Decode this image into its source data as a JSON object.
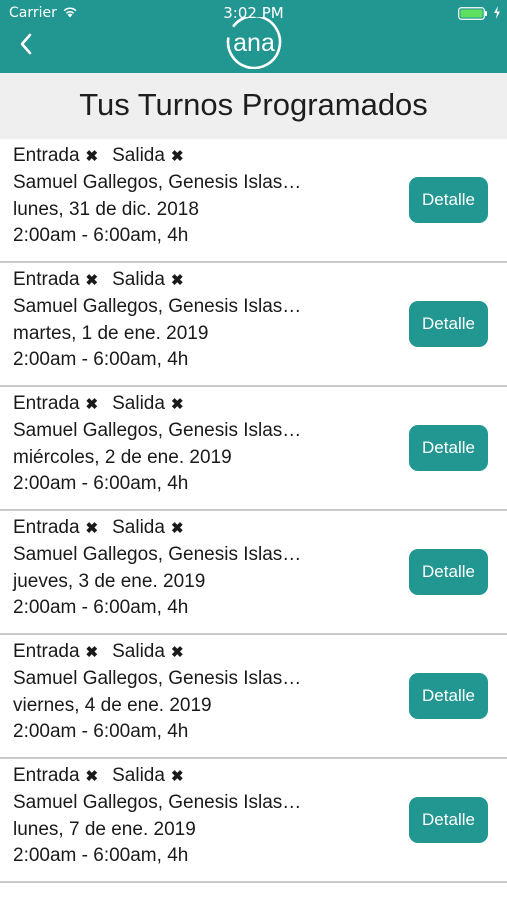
{
  "status_bar": {
    "carrier": "Carrier",
    "time": "3:02 PM"
  },
  "header": {
    "background_color": "#229691",
    "logo_text": "ana"
  },
  "page": {
    "title": "Tus Turnos Programados"
  },
  "shifts": [
    {
      "entrada_label": "Entrada",
      "salida_label": "Salida",
      "x_mark": "✖",
      "names": "Samuel Gallegos, Genesis Islas…",
      "date": "lunes, 31 de dic. 2018",
      "time_range": "2:00am - 6:00am, 4h",
      "button_label": "Detalle"
    },
    {
      "entrada_label": "Entrada",
      "salida_label": "Salida",
      "x_mark": "✖",
      "names": "Samuel Gallegos, Genesis Islas…",
      "date": "martes, 1 de ene. 2019",
      "time_range": "2:00am - 6:00am, 4h",
      "button_label": "Detalle"
    },
    {
      "entrada_label": "Entrada",
      "salida_label": "Salida",
      "x_mark": "✖",
      "names": "Samuel Gallegos, Genesis Islas…",
      "date": "miércoles, 2 de ene. 2019",
      "time_range": "2:00am - 6:00am, 4h",
      "button_label": "Detalle"
    },
    {
      "entrada_label": "Entrada",
      "salida_label": "Salida",
      "x_mark": "✖",
      "names": "Samuel Gallegos, Genesis Islas…",
      "date": "jueves, 3 de ene. 2019",
      "time_range": "2:00am - 6:00am, 4h",
      "button_label": "Detalle"
    },
    {
      "entrada_label": "Entrada",
      "salida_label": "Salida",
      "x_mark": "✖",
      "names": "Samuel Gallegos, Genesis Islas…",
      "date": "viernes, 4 de ene. 2019",
      "time_range": "2:00am - 6:00am, 4h",
      "button_label": "Detalle"
    },
    {
      "entrada_label": "Entrada",
      "salida_label": "Salida",
      "x_mark": "✖",
      "names": "Samuel Gallegos, Genesis Islas…",
      "date": "lunes, 7 de ene. 2019",
      "time_range": "2:00am - 6:00am, 4h",
      "button_label": "Detalle"
    }
  ],
  "icons": {
    "back": "chevron-left-icon",
    "wifi": "wifi-icon",
    "battery": "battery-icon",
    "charge": "charging-bolt-icon"
  }
}
